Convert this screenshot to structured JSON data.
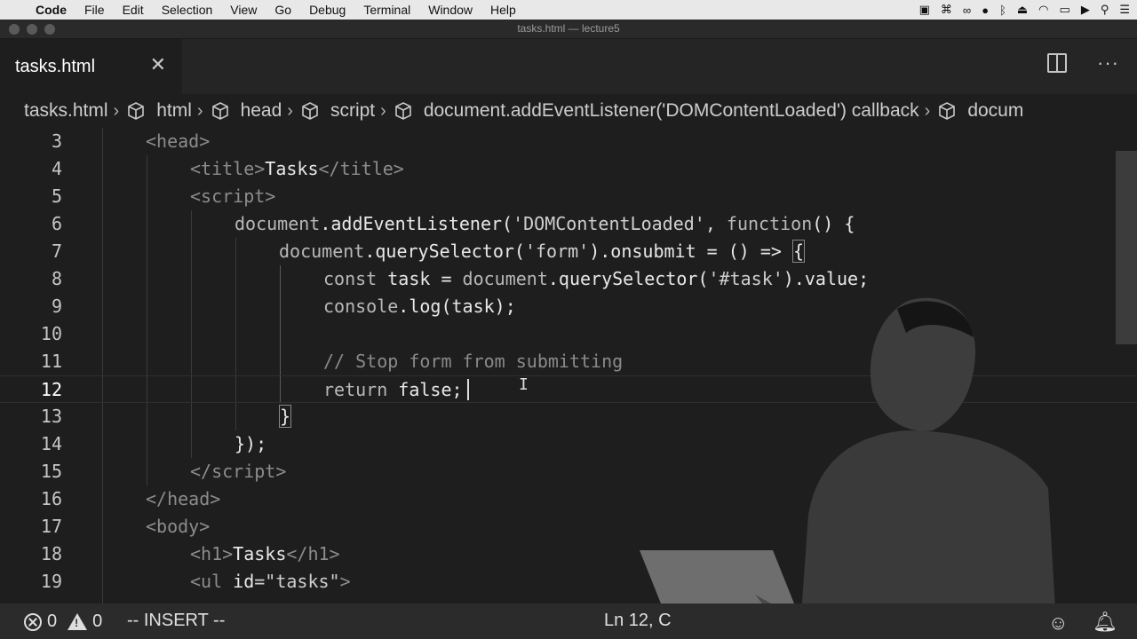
{
  "menubar": {
    "app_name": "Code",
    "items": [
      "File",
      "Edit",
      "Selection",
      "View",
      "Go",
      "Debug",
      "Terminal",
      "Window",
      "Help"
    ]
  },
  "window": {
    "title": "tasks.html — lecture5"
  },
  "tab": {
    "label": "tasks.html",
    "close": "✕"
  },
  "breadcrumb": {
    "items": [
      "tasks.html",
      "html",
      "head",
      "script",
      "document.addEventListener('DOMContentLoaded') callback",
      "docum"
    ]
  },
  "editor": {
    "line_numbers": [
      "3",
      "4",
      "5",
      "6",
      "7",
      "8",
      "9",
      "10",
      "11",
      "12",
      "13",
      "14",
      "15",
      "16",
      "17",
      "18",
      "19"
    ],
    "lines": {
      "l3": "<head>",
      "l4a": "<title>",
      "l4b": "Tasks",
      "l4c": "</title>",
      "l5": "<script>",
      "l6a": "document",
      "l6b": ".addEventListener(",
      "l6c": "'DOMContentLoaded'",
      "l6d": ", ",
      "l6e": "function",
      "l6f": "() {",
      "l7a": "document",
      "l7b": ".querySelector(",
      "l7c": "'form'",
      "l7d": ").onsubmit = () => ",
      "l7e": "{",
      "l8a": "const",
      "l8b": " task = ",
      "l8c": "document",
      "l8d": ".querySelector(",
      "l8e": "'#task'",
      "l8f": ").value;",
      "l9a": "console",
      "l9b": ".log(task);",
      "l11": "// Stop form from submitting",
      "l12a": "return",
      "l12b": " false;",
      "l13": "}",
      "l14": "});",
      "l15": "</script>",
      "l16": "</head>",
      "l17": "<body>",
      "l18a": "<h1>",
      "l18b": "Tasks",
      "l18c": "</h1>",
      "l19a": "<ul ",
      "l19b": "id",
      "l19c": "=\"tasks\"",
      "l19d": ">"
    }
  },
  "statusbar": {
    "errors": "0",
    "warnings": "0",
    "mode": "-- INSERT --",
    "position": "Ln 12, C"
  }
}
